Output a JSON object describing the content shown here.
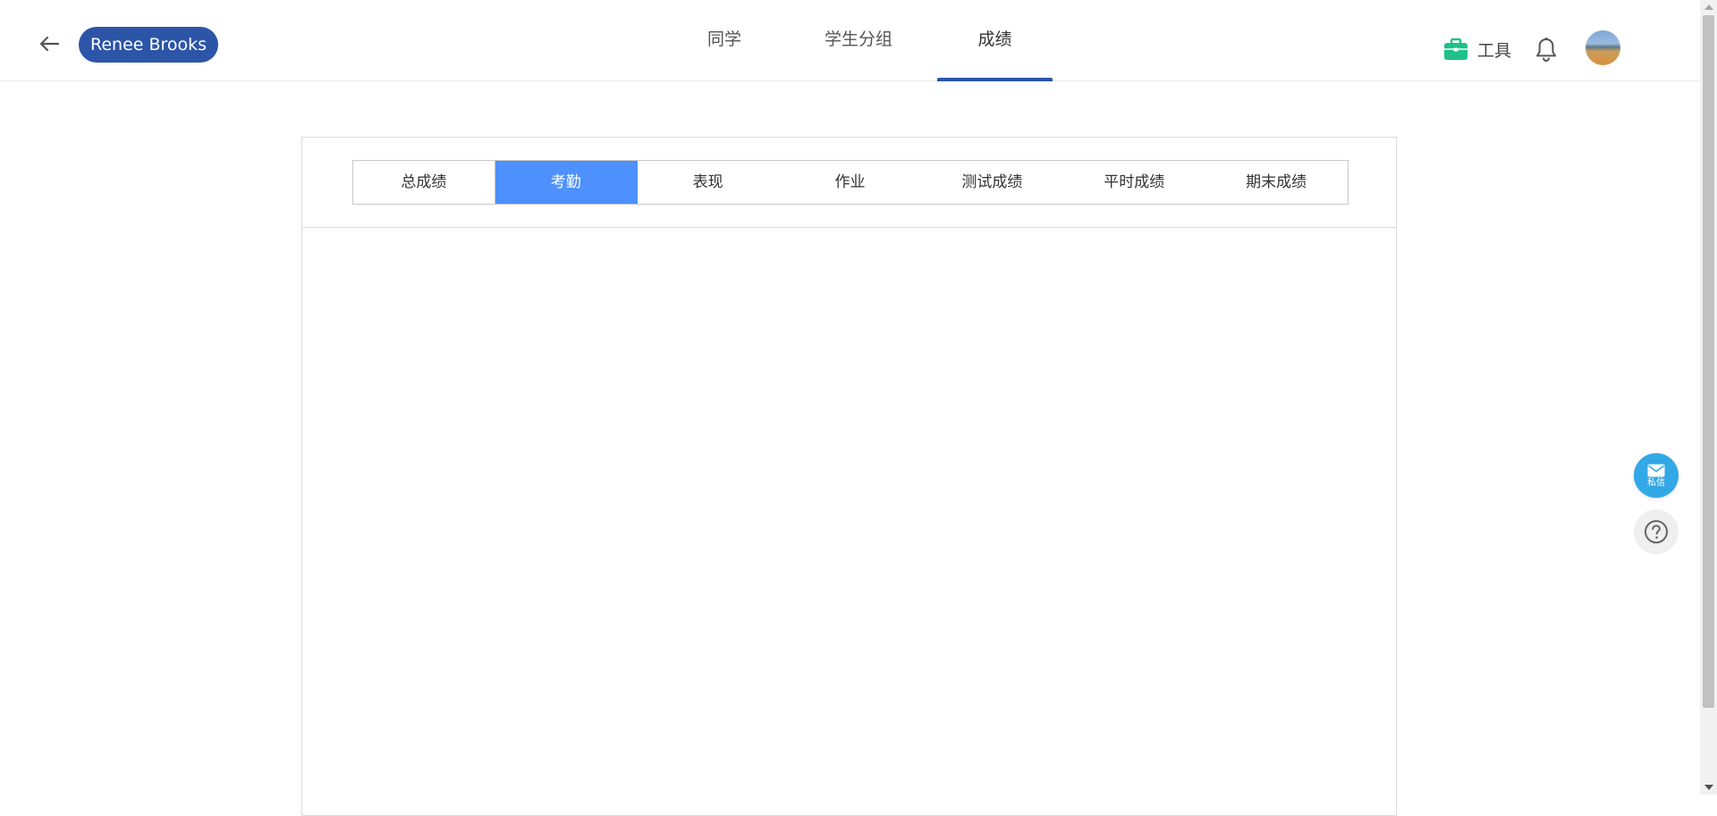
{
  "header": {
    "user_name": "Renee Brooks",
    "tabs": [
      {
        "label": "同学",
        "active": false
      },
      {
        "label": "学生分组",
        "active": false
      },
      {
        "label": "成绩",
        "active": true
      }
    ],
    "tools_label": "工具",
    "accent_color": "#2c55a8",
    "tools_icon_color": "#1fc08a"
  },
  "grades": {
    "subtabs": [
      {
        "label": "总成绩",
        "active": false
      },
      {
        "label": "考勤",
        "active": true
      },
      {
        "label": "表现",
        "active": false
      },
      {
        "label": "作业",
        "active": false
      },
      {
        "label": "测试成绩",
        "active": false
      },
      {
        "label": "平时成绩",
        "active": false
      },
      {
        "label": "期末成绩",
        "active": false
      }
    ],
    "active_color": "#4d90fe"
  },
  "floating": {
    "message_label": "私信",
    "message_icon": "mail-icon",
    "help_icon": "help-icon"
  }
}
